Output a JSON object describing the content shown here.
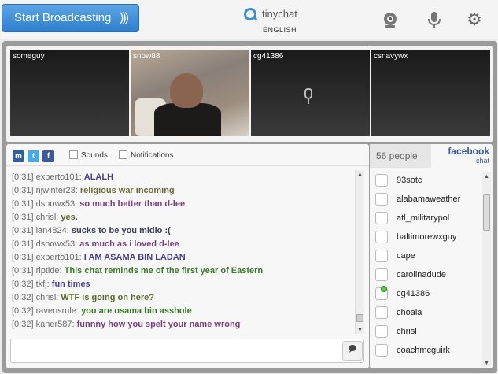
{
  "topbar": {
    "start_button": "Start Broadcasting",
    "logo_name": "tinychat",
    "language": "ENGLISH",
    "icons": [
      "webcam-icon",
      "microphone-icon",
      "gear-icon"
    ]
  },
  "videos": [
    {
      "label": "someguy"
    },
    {
      "label": "snow88"
    },
    {
      "label": "cg41386"
    },
    {
      "label": "csnavywx"
    }
  ],
  "chat": {
    "toolbar": {
      "sounds_label": "Sounds",
      "notifications_label": "Notifications"
    },
    "messages": [
      {
        "time": "[0:31]",
        "user": "experto101:",
        "text": "ALALH",
        "color": "#4a3f8f"
      },
      {
        "time": "[0:31]",
        "user": "njwinter23:",
        "text": "religious war incoming",
        "color": "#6b6b3a"
      },
      {
        "time": "[0:31]",
        "user": "dsnowx53:",
        "text": "so much better than d-lee",
        "color": "#7a3f7a"
      },
      {
        "time": "[0:31]",
        "user": "chrisl:",
        "text": "yes.",
        "color": "#5a6a2a"
      },
      {
        "time": "[0:31]",
        "user": "ian4824:",
        "text": "sucks to be you midlo :(",
        "color": "#3a3a5a"
      },
      {
        "time": "[0:31]",
        "user": "dsnowx53:",
        "text": "as much as i loved d-lee",
        "color": "#7a3f7a"
      },
      {
        "time": "[0:31]",
        "user": "experto101:",
        "text": "I AM ASAMA BIN LADAN",
        "color": "#4a3f8f"
      },
      {
        "time": "[0:31]",
        "user": "riptide:",
        "text": "This chat reminds me of the first year of Eastern",
        "color": "#3a7a2a"
      },
      {
        "time": "[0:32]",
        "user": "tkfj:",
        "text": "fun times",
        "color": "#4a3f8f"
      },
      {
        "time": "[0:32]",
        "user": "chrisl:",
        "text": "WTF is going on here?",
        "color": "#5a6a2a"
      },
      {
        "time": "[0:32]",
        "user": "ravensrule:",
        "text": "you are osama bin asshole",
        "color": "#3a7a2a"
      },
      {
        "time": "[0:32]",
        "user": "kaner587:",
        "text": "funnny how you spelt your name wrong",
        "color": "#7a3f7a"
      }
    ],
    "input_placeholder": ""
  },
  "people": {
    "count_label": "56 people",
    "facebook_label": "facebook",
    "facebook_sub": "chat",
    "users": [
      {
        "name": "93sotc",
        "on_cam": false
      },
      {
        "name": "alabamaweather",
        "on_cam": false
      },
      {
        "name": "atl_militarypol",
        "on_cam": false
      },
      {
        "name": "baltimorewxguy",
        "on_cam": false
      },
      {
        "name": "cape",
        "on_cam": false
      },
      {
        "name": "carolinadude",
        "on_cam": false
      },
      {
        "name": "cg41386",
        "on_cam": true
      },
      {
        "name": "choala",
        "on_cam": false
      },
      {
        "name": "chrisl",
        "on_cam": false
      },
      {
        "name": "coachmcguirk",
        "on_cam": false
      }
    ]
  }
}
